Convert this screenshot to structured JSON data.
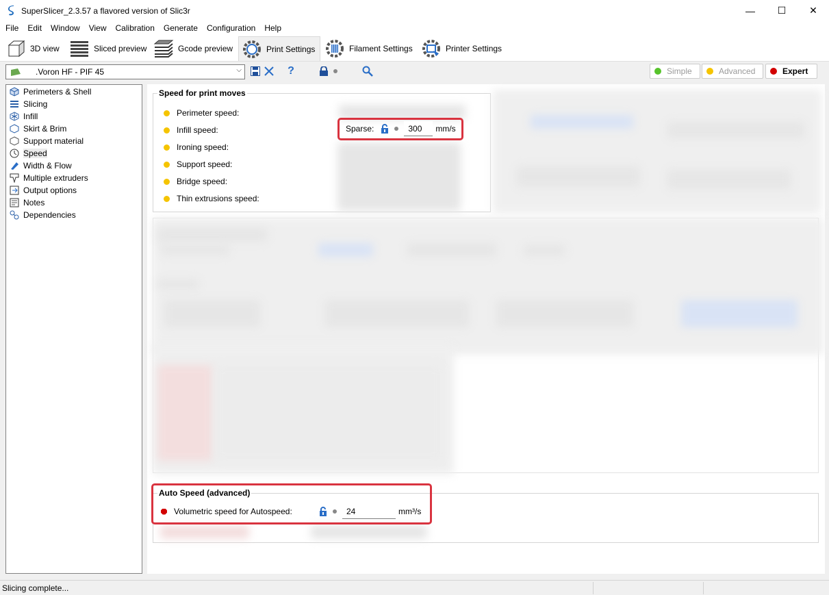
{
  "window": {
    "title": "SuperSlicer_2.3.57 a flavored version of Slic3r",
    "minimize": "—",
    "maximize": "☐",
    "close": "✕"
  },
  "menu": [
    "File",
    "Edit",
    "Window",
    "View",
    "Calibration",
    "Generate",
    "Configuration",
    "Help"
  ],
  "tabs": [
    {
      "label": "3D view",
      "icon": "cube-icon"
    },
    {
      "label": "Sliced preview",
      "icon": "layers-icon"
    },
    {
      "label": "Gcode preview",
      "icon": "stack-icon"
    },
    {
      "label": "Print Settings",
      "icon": "gear-icon",
      "active": true
    },
    {
      "label": "Filament Settings",
      "icon": "filament-gear-icon"
    },
    {
      "label": "Printer Settings",
      "icon": "printer-gear-icon"
    }
  ],
  "preset": {
    "name": ".Voron HF - PIF 45",
    "flag_color": "#6aa84f"
  },
  "modes": {
    "simple": "Simple",
    "advanced": "Advanced",
    "expert": "Expert",
    "simple_color": "#57c32b",
    "advanced_color": "#f5c400",
    "expert_color": "#d20000"
  },
  "sidebar": [
    {
      "label": "Perimeters & Shell",
      "icon": "perimeters-icon"
    },
    {
      "label": "Slicing",
      "icon": "slicing-icon"
    },
    {
      "label": "Infill",
      "icon": "infill-icon"
    },
    {
      "label": "Skirt & Brim",
      "icon": "skirt-icon"
    },
    {
      "label": "Support material",
      "icon": "support-icon"
    },
    {
      "label": "Speed",
      "icon": "speed-icon",
      "selected": true
    },
    {
      "label": "Width & Flow",
      "icon": "width-flow-icon"
    },
    {
      "label": "Multiple extruders",
      "icon": "extruders-icon"
    },
    {
      "label": "Output options",
      "icon": "output-icon"
    },
    {
      "label": "Notes",
      "icon": "notes-icon"
    },
    {
      "label": "Dependencies",
      "icon": "dependencies-icon"
    }
  ],
  "speed_group": {
    "title": "Speed for print moves",
    "rows": [
      "Perimeter speed:",
      "Infill speed:",
      "Ironing speed:",
      "Support speed:",
      "Bridge speed:",
      "Thin extrusions speed:"
    ],
    "sparse_label": "Sparse:",
    "sparse_value": "300",
    "sparse_unit": "mm/s"
  },
  "autospeed_group": {
    "title": "Auto Speed (advanced)",
    "label": "Volumetric speed for Autospeed:",
    "value": "24",
    "unit": "mm³/s"
  },
  "status": {
    "text": "Slicing complete..."
  }
}
